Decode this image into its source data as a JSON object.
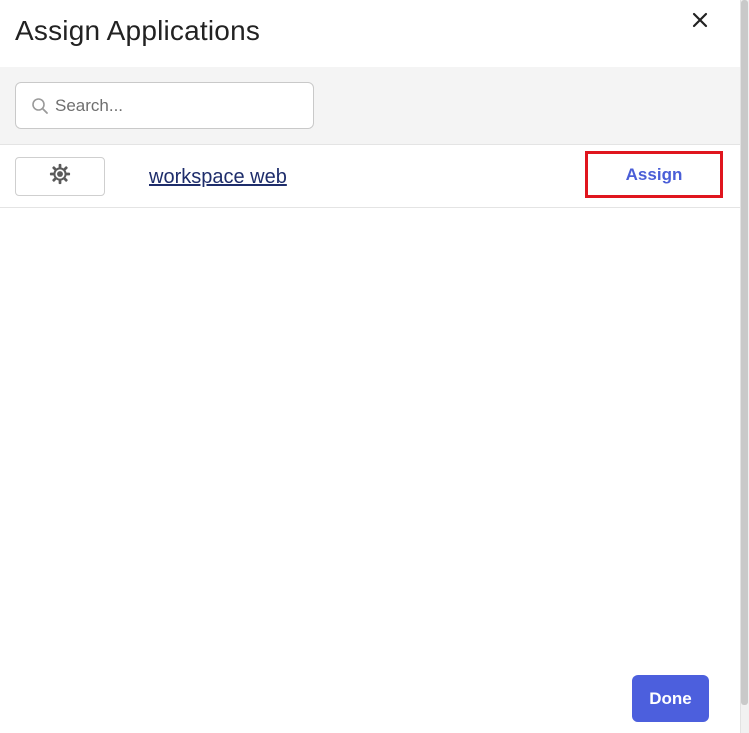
{
  "dialog": {
    "title": "Assign Applications",
    "close_icon": "close-icon"
  },
  "search": {
    "placeholder": "Search...",
    "value": "",
    "icon": "search-icon"
  },
  "applications": [
    {
      "icon": "gear-icon",
      "name": "workspace web",
      "action_label": "Assign"
    }
  ],
  "footer": {
    "done_label": "Done"
  },
  "colors": {
    "accent": "#4c5fdd",
    "highlight_border": "#e0151e",
    "link": "#1e2d6b"
  }
}
